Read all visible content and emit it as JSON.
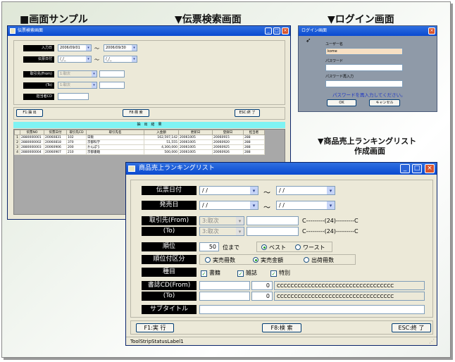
{
  "headings": {
    "sample": "■画面サンプル",
    "slip_search": "▼伝票検索画面",
    "login": "▼ログイン画面",
    "ranking_line1": "▼商品売上ランキングリスト",
    "ranking_line2": "作成画面"
  },
  "slip_window": {
    "title": "伝票検索画面",
    "input_date_label": "入力日",
    "input_date_from": "2006/09/01",
    "input_date_to": "2006/09/30",
    "tilde": "～",
    "slip_date_label": "伝票日付",
    "slip_date_from": "/_/_",
    "slip_date_to": "/_/_",
    "client_from_label": "取引先(From)",
    "client_to_label": "(To)",
    "client_select": "1:取次",
    "staff_label": "担当者CD",
    "btn_f1": "F1:抽 出",
    "btn_f8": "F8:検 索",
    "btn_esc": "ESC:終 了",
    "result_header": "抽　出　結　果",
    "columns": [
      "伝票NO",
      "伝票日付",
      "取引先CD",
      "取引先名",
      "入金額",
      "更新日",
      "登録日",
      "担当者"
    ],
    "rows": [
      {
        "no": "1",
        "cells": [
          "2880000001",
          "20060831",
          "102",
          "日販",
          "162,597,142",
          "20061005",
          "20060915",
          "288"
        ]
      },
      {
        "no": "2",
        "cells": [
          "2880000002",
          "20060818",
          "370",
          "京都科学",
          "51,555",
          "20061005",
          "20060920",
          "288"
        ]
      },
      {
        "no": "3",
        "cells": [
          "2880000003",
          "20060906",
          "200",
          "かんぽう",
          "4,300,000",
          "20061005",
          "20060925",
          "288"
        ]
      },
      {
        "no": "4",
        "cells": [
          "2880000004",
          "20060907",
          "210",
          "京都書籍",
          "500,000",
          "20061005",
          "20060926",
          "288"
        ]
      }
    ]
  },
  "login_window": {
    "title": "ログイン画面",
    "user_label": "ユーザー名",
    "user_value": "kome",
    "password_label": "パスワード",
    "password_confirm_label": "パスワード再入力",
    "message": "パスワードを再入力してください。",
    "ok_label": "OK",
    "cancel_label": "キャンセル"
  },
  "ranking_window": {
    "title": "商品売上ランキングリスト",
    "slip_date_label": "伝票日付",
    "release_date_label": "発売日",
    "date_placeholder": "/ /",
    "tilde": "～",
    "client_from_label": "取引先(From)",
    "client_to_label": "(To)",
    "client_select": "3:取次",
    "client_from_hint": "C---------(24)---------C",
    "client_to_hint": "C---------(24)---------C",
    "rank_label": "順位",
    "rank_value": "50",
    "rank_suffix": "位まで",
    "best_label": "ベスト",
    "worst_label": "ワースト",
    "rank_type_label": "順位付区分",
    "sales_qty_label": "実売冊数",
    "sales_amount_label": "実売金額",
    "ship_qty_label": "出荷冊数",
    "kind_label": "種目",
    "kind_book": "書籍",
    "kind_magazine": "雑誌",
    "kind_special": "特別",
    "book_cd_from_label": "書誌CD(From)",
    "book_cd_to_label": "(To)",
    "zero": "0",
    "book_cd_hint": "CCCCCCCCCCCCCCCCCCCCCCCCCCCCCCCCCC",
    "subtitle_label": "サブタイトル",
    "btn_f1": "F1:実 行",
    "btn_f8": "F8:検 索",
    "btn_esc": "ESC:終 了",
    "status": "ToolStripStatusLabel1"
  }
}
